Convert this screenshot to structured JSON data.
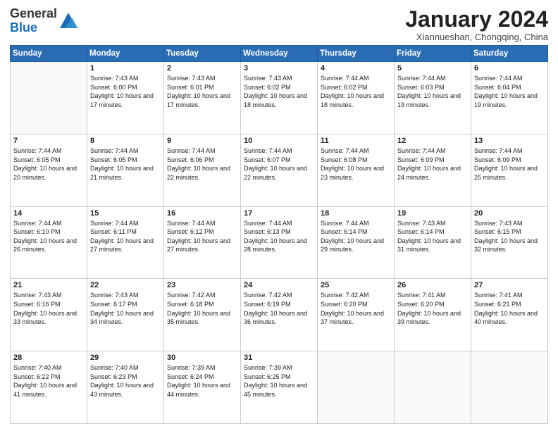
{
  "header": {
    "logo_general": "General",
    "logo_blue": "Blue",
    "month_title": "January 2024",
    "location": "Xiannueshan, Chongqing, China"
  },
  "days_of_week": [
    "Sunday",
    "Monday",
    "Tuesday",
    "Wednesday",
    "Thursday",
    "Friday",
    "Saturday"
  ],
  "weeks": [
    [
      {
        "day": "",
        "info": ""
      },
      {
        "day": "1",
        "info": "Sunrise: 7:43 AM\nSunset: 6:00 PM\nDaylight: 10 hours and 17 minutes."
      },
      {
        "day": "2",
        "info": "Sunrise: 7:43 AM\nSunset: 6:01 PM\nDaylight: 10 hours and 17 minutes."
      },
      {
        "day": "3",
        "info": "Sunrise: 7:43 AM\nSunset: 6:02 PM\nDaylight: 10 hours and 18 minutes."
      },
      {
        "day": "4",
        "info": "Sunrise: 7:44 AM\nSunset: 6:02 PM\nDaylight: 10 hours and 18 minutes."
      },
      {
        "day": "5",
        "info": "Sunrise: 7:44 AM\nSunset: 6:03 PM\nDaylight: 10 hours and 19 minutes."
      },
      {
        "day": "6",
        "info": "Sunrise: 7:44 AM\nSunset: 6:04 PM\nDaylight: 10 hours and 19 minutes."
      }
    ],
    [
      {
        "day": "7",
        "info": "Sunrise: 7:44 AM\nSunset: 6:05 PM\nDaylight: 10 hours and 20 minutes."
      },
      {
        "day": "8",
        "info": "Sunrise: 7:44 AM\nSunset: 6:05 PM\nDaylight: 10 hours and 21 minutes."
      },
      {
        "day": "9",
        "info": "Sunrise: 7:44 AM\nSunset: 6:06 PM\nDaylight: 10 hours and 22 minutes."
      },
      {
        "day": "10",
        "info": "Sunrise: 7:44 AM\nSunset: 6:07 PM\nDaylight: 10 hours and 22 minutes."
      },
      {
        "day": "11",
        "info": "Sunrise: 7:44 AM\nSunset: 6:08 PM\nDaylight: 10 hours and 23 minutes."
      },
      {
        "day": "12",
        "info": "Sunrise: 7:44 AM\nSunset: 6:09 PM\nDaylight: 10 hours and 24 minutes."
      },
      {
        "day": "13",
        "info": "Sunrise: 7:44 AM\nSunset: 6:09 PM\nDaylight: 10 hours and 25 minutes."
      }
    ],
    [
      {
        "day": "14",
        "info": "Sunrise: 7:44 AM\nSunset: 6:10 PM\nDaylight: 10 hours and 26 minutes."
      },
      {
        "day": "15",
        "info": "Sunrise: 7:44 AM\nSunset: 6:11 PM\nDaylight: 10 hours and 27 minutes."
      },
      {
        "day": "16",
        "info": "Sunrise: 7:44 AM\nSunset: 6:12 PM\nDaylight: 10 hours and 27 minutes."
      },
      {
        "day": "17",
        "info": "Sunrise: 7:44 AM\nSunset: 6:13 PM\nDaylight: 10 hours and 28 minutes."
      },
      {
        "day": "18",
        "info": "Sunrise: 7:44 AM\nSunset: 6:14 PM\nDaylight: 10 hours and 29 minutes."
      },
      {
        "day": "19",
        "info": "Sunrise: 7:43 AM\nSunset: 6:14 PM\nDaylight: 10 hours and 31 minutes."
      },
      {
        "day": "20",
        "info": "Sunrise: 7:43 AM\nSunset: 6:15 PM\nDaylight: 10 hours and 32 minutes."
      }
    ],
    [
      {
        "day": "21",
        "info": "Sunrise: 7:43 AM\nSunset: 6:16 PM\nDaylight: 10 hours and 33 minutes."
      },
      {
        "day": "22",
        "info": "Sunrise: 7:43 AM\nSunset: 6:17 PM\nDaylight: 10 hours and 34 minutes."
      },
      {
        "day": "23",
        "info": "Sunrise: 7:42 AM\nSunset: 6:18 PM\nDaylight: 10 hours and 35 minutes."
      },
      {
        "day": "24",
        "info": "Sunrise: 7:42 AM\nSunset: 6:19 PM\nDaylight: 10 hours and 36 minutes."
      },
      {
        "day": "25",
        "info": "Sunrise: 7:42 AM\nSunset: 6:20 PM\nDaylight: 10 hours and 37 minutes."
      },
      {
        "day": "26",
        "info": "Sunrise: 7:41 AM\nSunset: 6:20 PM\nDaylight: 10 hours and 39 minutes."
      },
      {
        "day": "27",
        "info": "Sunrise: 7:41 AM\nSunset: 6:21 PM\nDaylight: 10 hours and 40 minutes."
      }
    ],
    [
      {
        "day": "28",
        "info": "Sunrise: 7:40 AM\nSunset: 6:22 PM\nDaylight: 10 hours and 41 minutes."
      },
      {
        "day": "29",
        "info": "Sunrise: 7:40 AM\nSunset: 6:23 PM\nDaylight: 10 hours and 43 minutes."
      },
      {
        "day": "30",
        "info": "Sunrise: 7:39 AM\nSunset: 6:24 PM\nDaylight: 10 hours and 44 minutes."
      },
      {
        "day": "31",
        "info": "Sunrise: 7:39 AM\nSunset: 6:25 PM\nDaylight: 10 hours and 45 minutes."
      },
      {
        "day": "",
        "info": ""
      },
      {
        "day": "",
        "info": ""
      },
      {
        "day": "",
        "info": ""
      }
    ]
  ]
}
